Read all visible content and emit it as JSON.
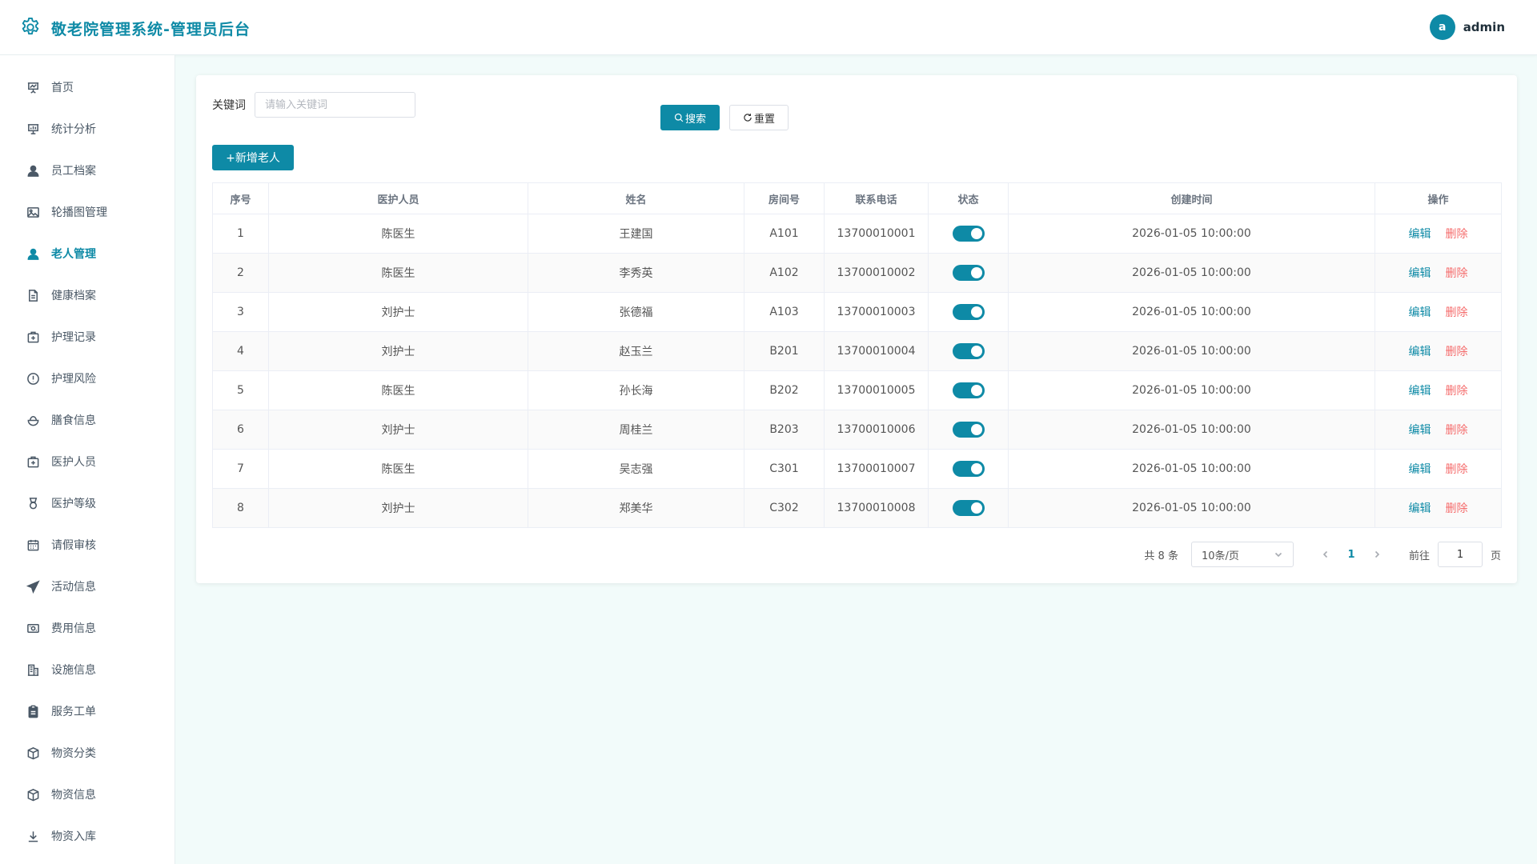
{
  "app": {
    "title": "敬老院管理系统-管理员后台",
    "user_initial": "a",
    "user_name": "admin",
    "accent_color": "#0e8aa6",
    "danger_color": "#f56c6c"
  },
  "sidebar": {
    "items": [
      {
        "label": "首页",
        "icon": "presentation-icon",
        "active": false
      },
      {
        "label": "统计分析",
        "icon": "chart-board-icon",
        "active": false
      },
      {
        "label": "员工档案",
        "icon": "user-icon",
        "active": false
      },
      {
        "label": "轮播图管理",
        "icon": "image-icon",
        "active": false
      },
      {
        "label": "老人管理",
        "icon": "user-icon",
        "active": true
      },
      {
        "label": "健康档案",
        "icon": "document-icon",
        "active": false
      },
      {
        "label": "护理记录",
        "icon": "first-aid-icon",
        "active": false
      },
      {
        "label": "护理风险",
        "icon": "warning-circle-icon",
        "active": false
      },
      {
        "label": "膳食信息",
        "icon": "bowl-icon",
        "active": false
      },
      {
        "label": "医护人员",
        "icon": "first-aid-icon",
        "active": false
      },
      {
        "label": "医护等级",
        "icon": "medal-icon",
        "active": false
      },
      {
        "label": "请假审核",
        "icon": "calendar-icon",
        "active": false
      },
      {
        "label": "活动信息",
        "icon": "paper-plane-icon",
        "active": false
      },
      {
        "label": "费用信息",
        "icon": "money-icon",
        "active": false
      },
      {
        "label": "设施信息",
        "icon": "building-icon",
        "active": false
      },
      {
        "label": "服务工单",
        "icon": "clipboard-icon",
        "active": false
      },
      {
        "label": "物资分类",
        "icon": "box-icon",
        "active": false
      },
      {
        "label": "物资信息",
        "icon": "box-icon",
        "active": false
      },
      {
        "label": "物资入库",
        "icon": "download-icon",
        "active": false
      }
    ]
  },
  "search": {
    "label": "关键词",
    "placeholder": "请输入关键词",
    "value": "",
    "search_label": "搜索",
    "reset_label": "重置"
  },
  "toolbar": {
    "add_label": "+新增老人"
  },
  "table": {
    "headers": [
      "序号",
      "医护人员",
      "姓名",
      "房间号",
      "联系电话",
      "状态",
      "创建时间",
      "操作"
    ],
    "edit_label": "编辑",
    "delete_label": "删除",
    "rows": [
      {
        "index": "1",
        "staff": "陈医生",
        "name": "王建国",
        "room": "A101",
        "phone": "13700010001",
        "status": true,
        "created": "2026-01-05 10:00:00"
      },
      {
        "index": "2",
        "staff": "陈医生",
        "name": "李秀英",
        "room": "A102",
        "phone": "13700010002",
        "status": true,
        "created": "2026-01-05 10:00:00"
      },
      {
        "index": "3",
        "staff": "刘护士",
        "name": "张德福",
        "room": "A103",
        "phone": "13700010003",
        "status": true,
        "created": "2026-01-05 10:00:00"
      },
      {
        "index": "4",
        "staff": "刘护士",
        "name": "赵玉兰",
        "room": "B201",
        "phone": "13700010004",
        "status": true,
        "created": "2026-01-05 10:00:00"
      },
      {
        "index": "5",
        "staff": "陈医生",
        "name": "孙长海",
        "room": "B202",
        "phone": "13700010005",
        "status": true,
        "created": "2026-01-05 10:00:00"
      },
      {
        "index": "6",
        "staff": "刘护士",
        "name": "周桂兰",
        "room": "B203",
        "phone": "13700010006",
        "status": true,
        "created": "2026-01-05 10:00:00"
      },
      {
        "index": "7",
        "staff": "陈医生",
        "name": "吴志强",
        "room": "C301",
        "phone": "13700010007",
        "status": true,
        "created": "2026-01-05 10:00:00"
      },
      {
        "index": "8",
        "staff": "刘护士",
        "name": "郑美华",
        "room": "C302",
        "phone": "13700010008",
        "status": true,
        "created": "2026-01-05 10:00:00"
      }
    ]
  },
  "pagination": {
    "total_text": "共 8 条",
    "page_size": "10条/页",
    "current_page": "1",
    "goto_label": "前往",
    "goto_value": "1",
    "goto_suffix": "页"
  }
}
